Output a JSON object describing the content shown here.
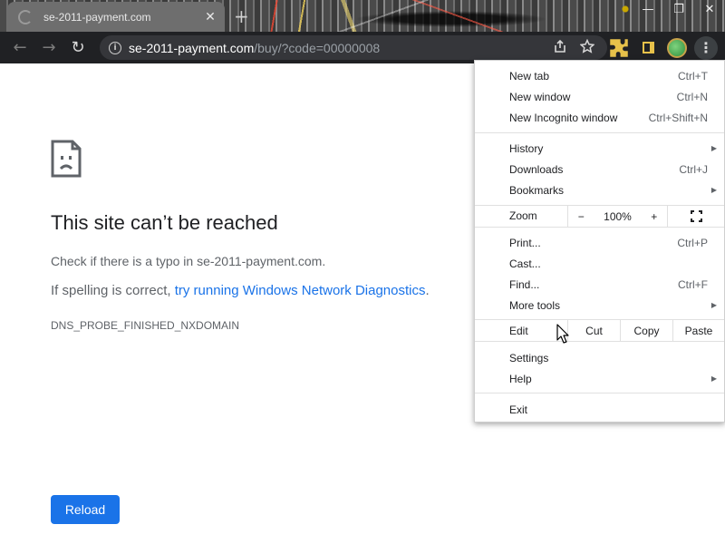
{
  "tab": {
    "title": "se-2011-payment.com",
    "close": "✕"
  },
  "newtab": "+",
  "window_controls": {
    "minimize": "—",
    "maximize": "❐",
    "close": "✕"
  },
  "toolbar": {
    "back": "←",
    "forward": "→",
    "reload": "↻"
  },
  "omnibox": {
    "host": "se-2011-payment.com",
    "path": "/buy/?code=00000008"
  },
  "page": {
    "title": "This site can’t be reached",
    "line1": "Check if there is a typo in se-2011-payment.com.",
    "line2_prefix": "If spelling is correct, ",
    "line2_link": "try running Windows Network Diagnostics",
    "line2_suffix": ".",
    "error_code": "DNS_PROBE_FINISHED_NXDOMAIN",
    "reload": "Reload"
  },
  "menu": {
    "new_tab": {
      "label": "New tab",
      "shortcut": "Ctrl+T"
    },
    "new_window": {
      "label": "New window",
      "shortcut": "Ctrl+N"
    },
    "new_incognito": {
      "label": "New Incognito window",
      "shortcut": "Ctrl+Shift+N"
    },
    "history": {
      "label": "History"
    },
    "downloads": {
      "label": "Downloads",
      "shortcut": "Ctrl+J"
    },
    "bookmarks": {
      "label": "Bookmarks"
    },
    "zoom": {
      "label": "Zoom",
      "minus": "−",
      "value": "100%",
      "plus": "+"
    },
    "print": {
      "label": "Print...",
      "shortcut": "Ctrl+P"
    },
    "cast": {
      "label": "Cast..."
    },
    "find": {
      "label": "Find...",
      "shortcut": "Ctrl+F"
    },
    "more_tools": {
      "label": "More tools"
    },
    "edit": {
      "label": "Edit",
      "cut": "Cut",
      "copy": "Copy",
      "paste": "Paste"
    },
    "settings": {
      "label": "Settings"
    },
    "help": {
      "label": "Help"
    },
    "exit": {
      "label": "Exit"
    },
    "submenu_arrow": "▶"
  }
}
